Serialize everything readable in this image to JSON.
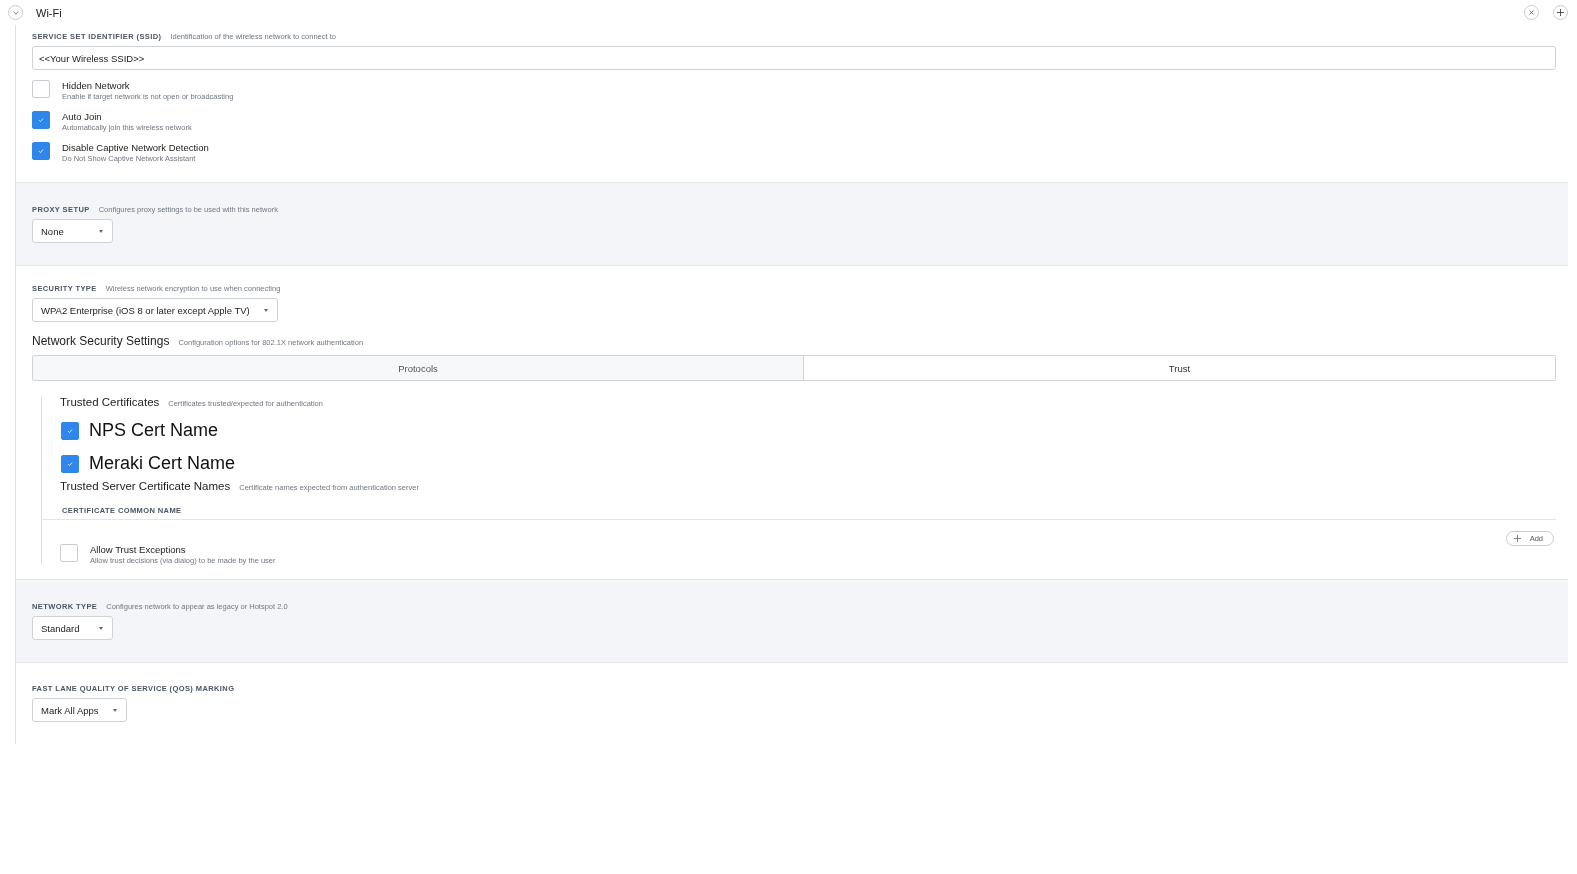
{
  "header": {
    "title": "Wi-Fi"
  },
  "ssid": {
    "label": "SERVICE SET IDENTIFIER (SSID)",
    "hint": "Identification of the wireless network to connect to",
    "value": "<<Your Wireless SSID>>"
  },
  "options": [
    {
      "label": "Hidden Network",
      "description": "Enable if target network is not open or broadcasting",
      "checked": false
    },
    {
      "label": "Auto Join",
      "description": "Automatically join this wireless network",
      "checked": true
    },
    {
      "label": "Disable Captive Network Detection",
      "description": "Do Not Show Captive Network Assistant",
      "checked": true
    }
  ],
  "proxy": {
    "label": "PROXY SETUP",
    "hint": "Configures proxy settings to be used with this network",
    "value": "None"
  },
  "security": {
    "label": "SECURITY TYPE",
    "hint": "Wireless network encryption to use when connecting",
    "value": "WPA2 Enterprise (iOS 8 or later except Apple TV)"
  },
  "network_security": {
    "title": "Network Security Settings",
    "hint": "Configuration options for 802.1X network authentication",
    "tabs": [
      {
        "label": "Protocols",
        "selected": false
      },
      {
        "label": "Trust",
        "selected": true
      }
    ],
    "trusted_certificates": {
      "title": "Trusted Certificates",
      "hint": "Certificates trusted/expected for authentication",
      "items": [
        {
          "label": "NPS Cert Name",
          "checked": true
        },
        {
          "label": "Meraki Cert Name",
          "checked": true
        }
      ]
    },
    "trusted_server_names": {
      "title": "Trusted Server Certificate Names",
      "hint": "Certificate names expected from authentication server",
      "columns": [
        "CERTIFICATE COMMON NAME"
      ],
      "add_button": "Add"
    },
    "allow_trust_exceptions": {
      "label": "Allow Trust Exceptions",
      "description": "Allow trust decisions (via dialog) to be made by the user",
      "checked": false
    }
  },
  "network_type": {
    "label": "NETWORK TYPE",
    "hint": "Configures network to appear as legacy or Hotspot 2.0",
    "value": "Standard"
  },
  "fast_lane": {
    "label": "FAST LANE QUALITY OF SERVICE (QOS) MARKING",
    "value": "Mark All Apps"
  }
}
